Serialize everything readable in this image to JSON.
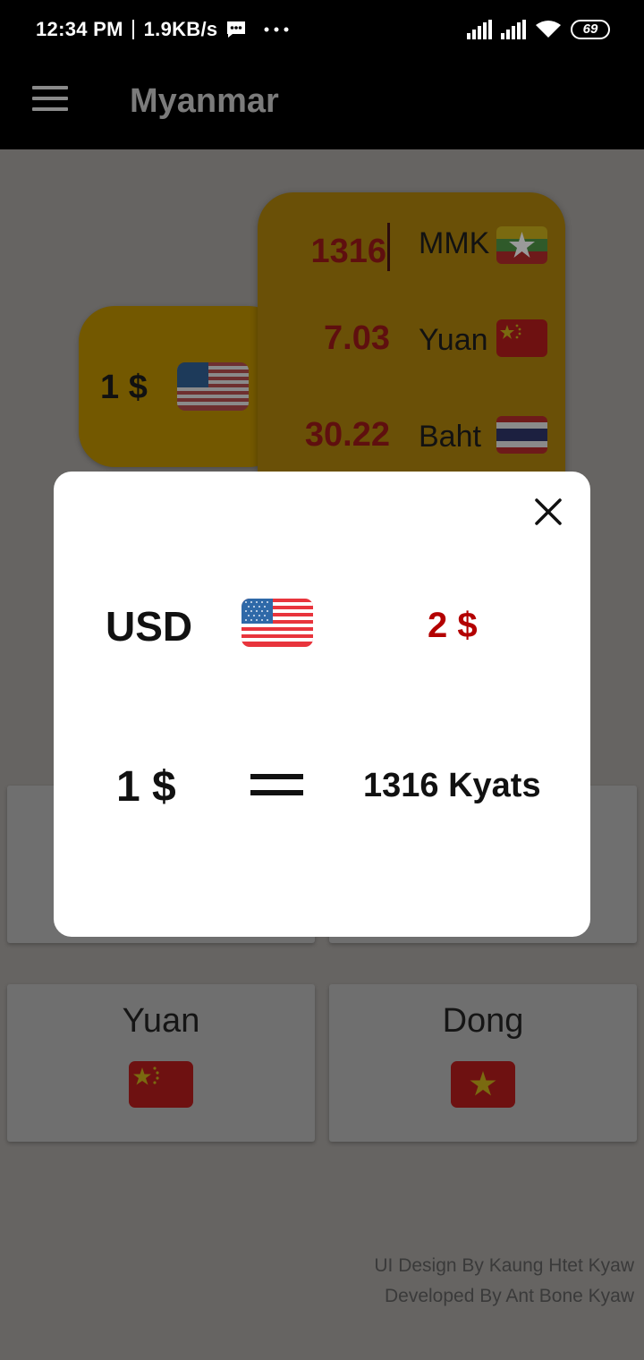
{
  "status_bar": {
    "time": "12:34 PM",
    "speed": "1.9KB/s",
    "battery": "69",
    "icons": [
      "message-icon",
      "more-dots-icon",
      "signal-icon",
      "signal-icon",
      "wifi-icon",
      "battery-icon"
    ]
  },
  "app_bar": {
    "title": "Myanmar",
    "menu_icon": "hamburger-menu-icon"
  },
  "base_card": {
    "value": "1 $",
    "flag": "usa-flag"
  },
  "rates": [
    {
      "value": "1316",
      "label": "MMK",
      "flag": "myanmar-flag"
    },
    {
      "value": "7.03",
      "label": "Yuan",
      "flag": "china-flag"
    },
    {
      "value": "30.22",
      "label": "Baht",
      "flag": "thailand-flag"
    }
  ],
  "tiles": [
    {
      "label": "Yuan",
      "flag": "china-flag"
    },
    {
      "label": "Dong",
      "flag": "vietnam-flag"
    }
  ],
  "credits": {
    "design": "UI Design By Kaung Htet Kyaw",
    "developer": "Developed By Ant Bone Kyaw"
  },
  "modal": {
    "currency_code": "USD",
    "flag": "usa-flag",
    "amount": "2 $",
    "base": "1 $",
    "equals_icon": "equals-icon",
    "result": "1316 Kyats",
    "close_icon": "close-icon"
  },
  "colors": {
    "status_bar_bg": "#000000",
    "overlay_bg": "#666462",
    "card_gold": "#735800",
    "rate_value": "#5f0f0f",
    "modal_amount": "#b30000"
  }
}
